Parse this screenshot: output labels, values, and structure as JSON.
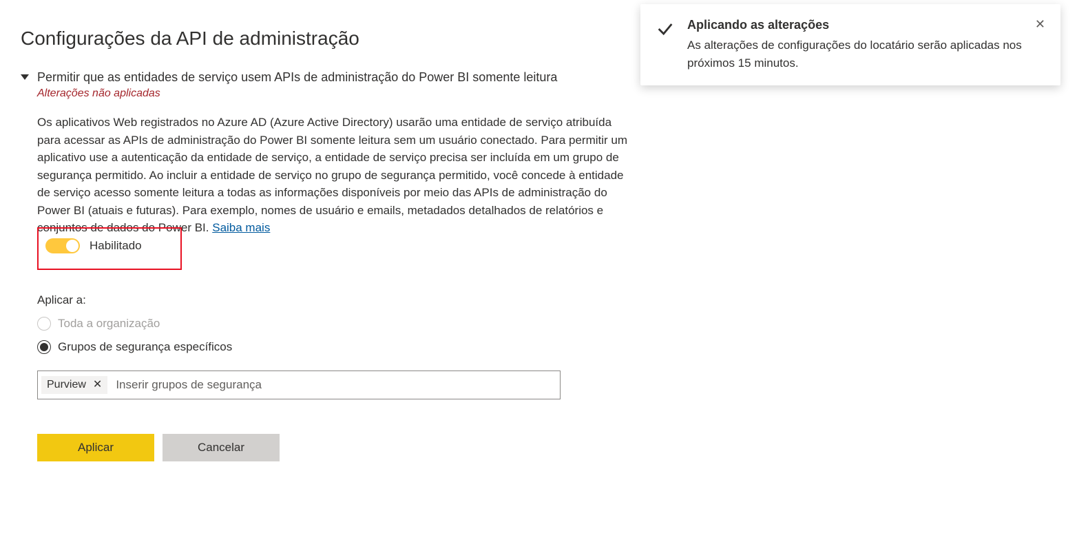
{
  "page_title": "Configurações da API de administração",
  "setting": {
    "title": "Permitir que as entidades de serviço usem APIs de administração do Power BI somente leitura",
    "unsaved_label": "Alterações não aplicadas",
    "description": "Os aplicativos Web registrados no Azure AD (Azure Active Directory) usarão uma entidade de serviço atribuída para acessar as APIs de administração do Power BI somente leitura sem um usuário conectado. Para permitir um aplicativo use a autenticação da entidade de serviço, a entidade de serviço precisa ser incluída em um grupo de segurança permitido. Ao incluir a entidade de serviço no grupo de segurança permitido, você concede à entidade de serviço acesso somente leitura a todas as informações disponíveis por meio das APIs de administração do Power BI (atuais e futuras). Para exemplo, nomes de usuário e emails, metadados detalhados de relatórios e conjuntos de dados do Power BI. ",
    "learn_more": "Saiba mais",
    "toggle_label": "Habilitado",
    "toggle_on": true
  },
  "apply_to": {
    "label": "Aplicar a:",
    "option_all": "Toda a organização",
    "option_groups": "Grupos de segurança específicos",
    "selected": "groups"
  },
  "group_input": {
    "tag": "Purview",
    "placeholder": "Inserir grupos de segurança"
  },
  "buttons": {
    "apply": "Aplicar",
    "cancel": "Cancelar"
  },
  "toast": {
    "title": "Aplicando as alterações",
    "message": "As alterações de configurações do locatário serão aplicadas nos próximos 15 minutos."
  }
}
